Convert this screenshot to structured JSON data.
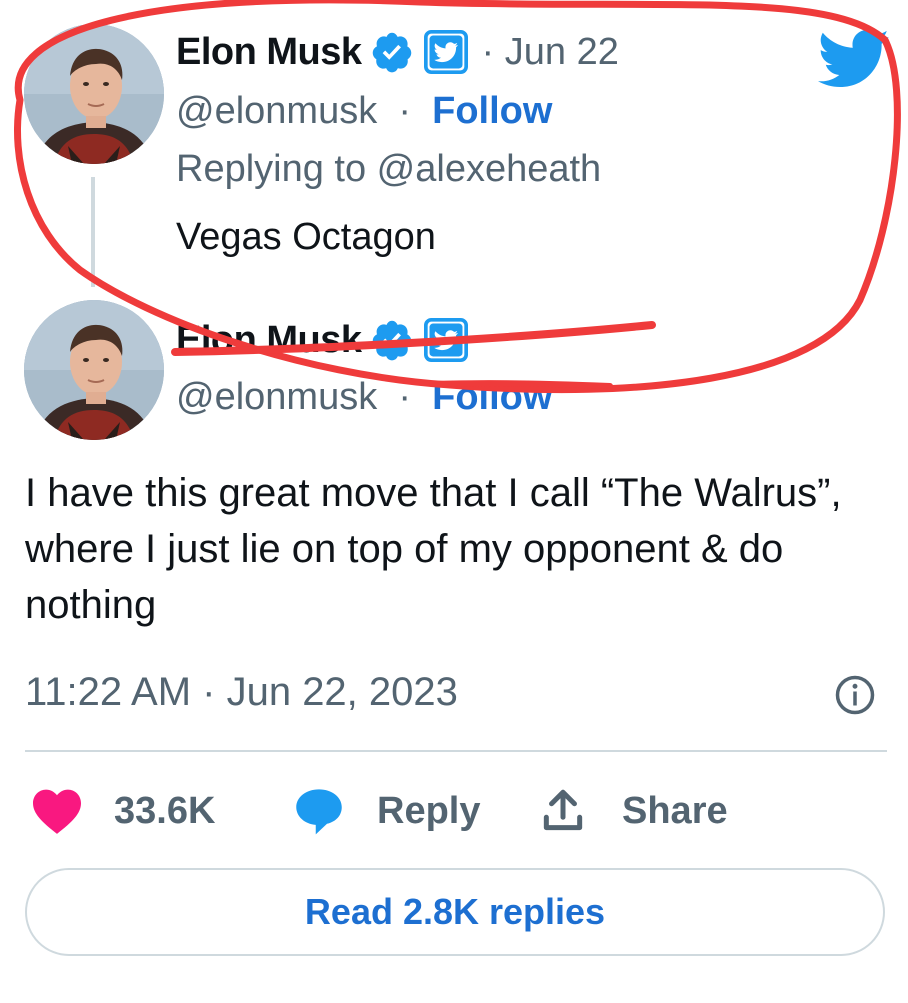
{
  "colors": {
    "accent": "#1d6fd1",
    "twitter_blue": "#1d9bf0",
    "like_pink": "#f91880",
    "muted": "#536471",
    "text": "#0f1419",
    "annotation_red": "#ef3b3b"
  },
  "parent_tweet": {
    "author_name": "Elon Musk",
    "handle": "@elonmusk",
    "separator": "·",
    "follow_label": "Follow",
    "date": "· Jun 22",
    "replying_to": "Replying to @alexeheath",
    "text": "Vegas Octagon"
  },
  "main_tweet": {
    "author_name": "Elon Musk",
    "handle": "@elonmusk",
    "separator": "·",
    "follow_label": "Follow",
    "text": "I have this great move that I call “The Walrus”, where I just lie on top of my opponent & do nothing",
    "timestamp": "11:22 AM · Jun 22, 2023"
  },
  "actions": {
    "likes": "33.6K",
    "reply_label": "Reply",
    "share_label": "Share"
  },
  "read_replies_label": "Read 2.8K replies",
  "icons": {
    "verified": "verified-badge-icon",
    "twitter_badge": "twitter-affiliate-icon",
    "twitter_logo": "twitter-bird-icon",
    "info": "info-icon",
    "like": "heart-icon",
    "reply": "speech-bubble-icon",
    "share": "share-upload-icon"
  }
}
